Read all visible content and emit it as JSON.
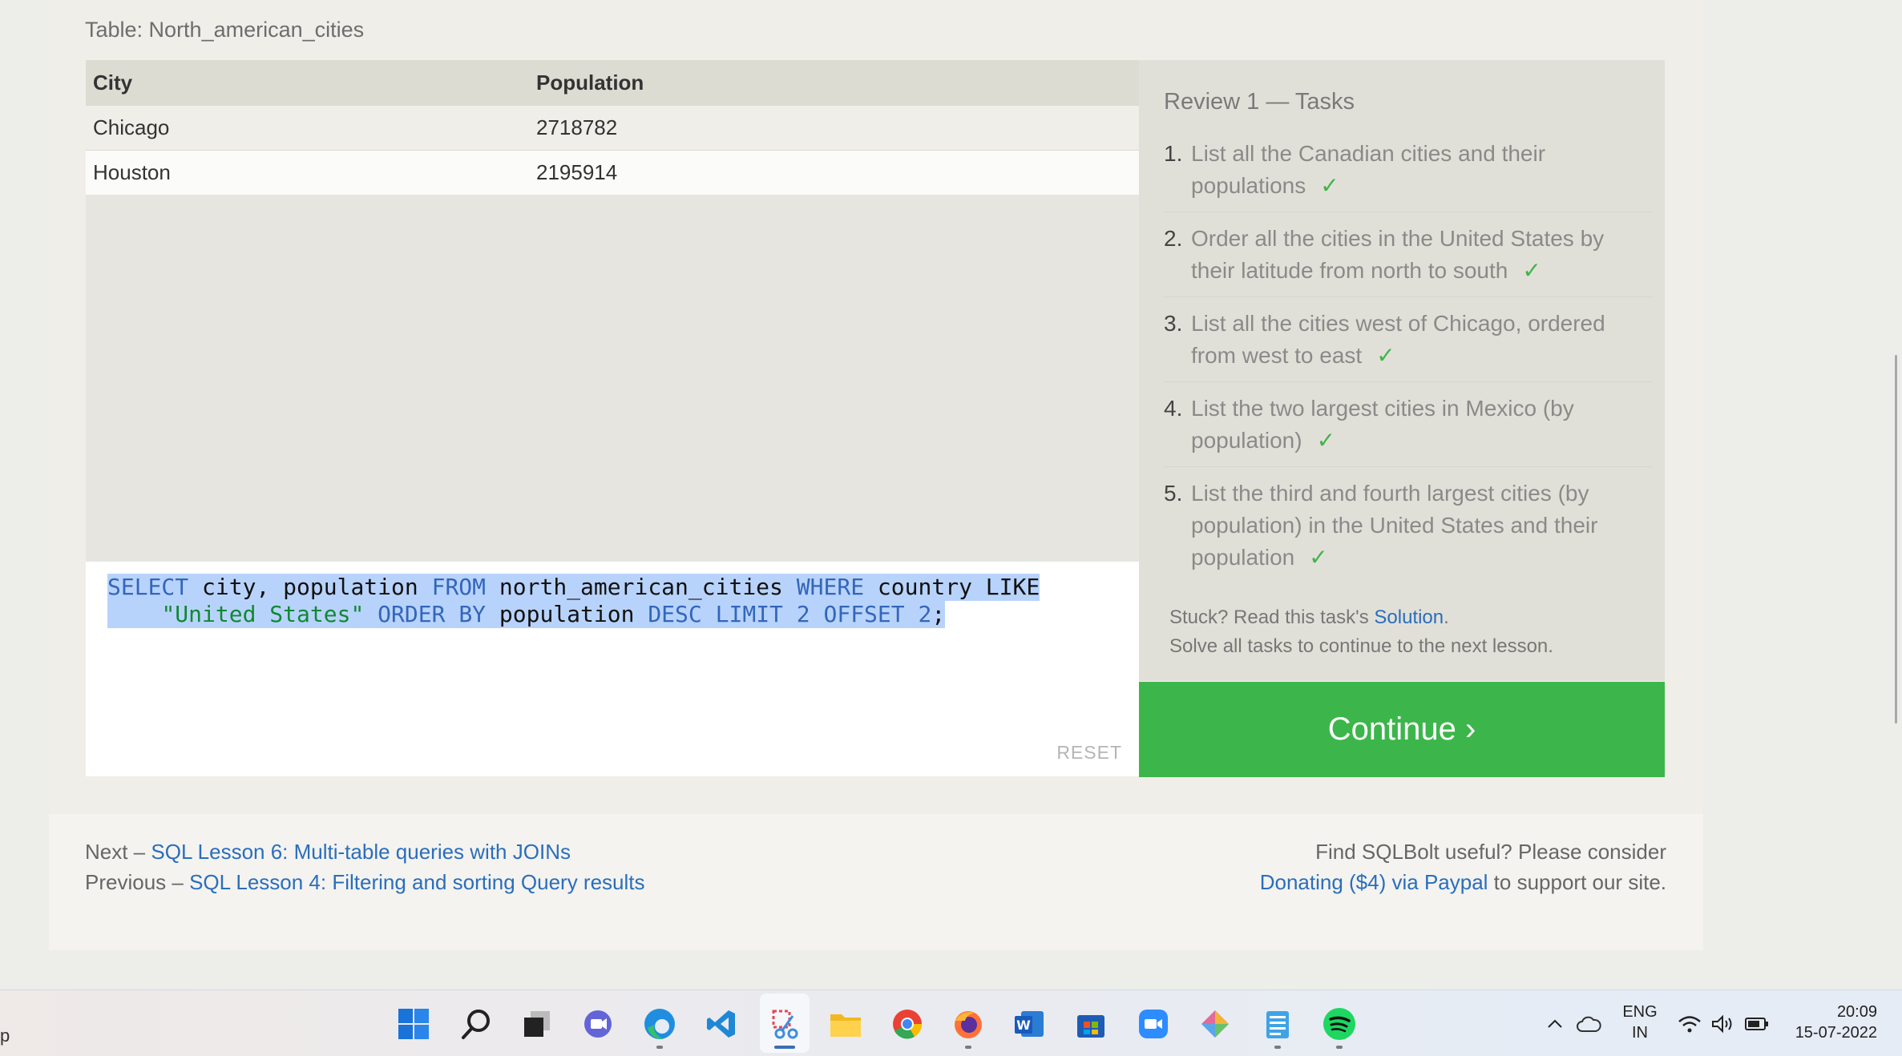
{
  "table_caption": "Table: North_american_cities",
  "results": {
    "columns": [
      "City",
      "Population"
    ],
    "rows": [
      [
        "Chicago",
        "2718782"
      ],
      [
        "Houston",
        "2195914"
      ]
    ]
  },
  "editor": {
    "line1": [
      {
        "t": "SELECT",
        "c": "kw"
      },
      {
        "t": " city, population ",
        "c": "id"
      },
      {
        "t": "FROM",
        "c": "kw"
      },
      {
        "t": " north_american_cities ",
        "c": "id"
      },
      {
        "t": "WHERE",
        "c": "kw"
      },
      {
        "t": " country LIKE",
        "c": "id"
      }
    ],
    "line2": [
      {
        "t": "    ",
        "c": "id"
      },
      {
        "t": "\"United States\"",
        "c": "str"
      },
      {
        "t": " ",
        "c": "id"
      },
      {
        "t": "ORDER BY",
        "c": "kw"
      },
      {
        "t": " population ",
        "c": "id"
      },
      {
        "t": "DESC LIMIT 2 OFFSET 2",
        "c": "kw"
      },
      {
        "t": ";",
        "c": "id"
      }
    ],
    "reset_label": "RESET"
  },
  "tasks": {
    "title": "Review 1 — Tasks",
    "items": [
      {
        "num": "1.",
        "text": "List all the Canadian cities and their populations",
        "check": "✓"
      },
      {
        "num": "2.",
        "text": "Order all the cities in the United States by their latitude from north to south",
        "check": "✓"
      },
      {
        "num": "3.",
        "text": "List all the cities west of Chicago, ordered from west to east",
        "check": "✓"
      },
      {
        "num": "4.",
        "text": "List the two largest cities in Mexico (by population)",
        "check": "✓"
      },
      {
        "num": "5.",
        "text": "List the third and fourth largest cities (by population) in the United States and their population",
        "check": "✓"
      }
    ],
    "stuck_prefix": "Stuck? Read this task's ",
    "solution_link": "Solution",
    "stuck_suffix": ".",
    "solve_note": "Solve all tasks to continue to the next lesson."
  },
  "continue_label": "Continue ›",
  "footer": {
    "next_prefix": "Next – ",
    "next_link": "SQL Lesson 6: Multi-table queries with JOINs",
    "prev_prefix": "Previous – ",
    "prev_link": "SQL Lesson 4: Filtering and sorting Query results",
    "support_line": "Find SQLBolt useful? Please consider",
    "donate_link": "Donating ($4) via Paypal",
    "donate_suffix": " to support our site."
  },
  "taskbar": {
    "cut_text": "p",
    "apps": [
      "windows-start-icon",
      "search-icon",
      "task-view-icon",
      "teams-chat-icon",
      "edge-icon",
      "vscode-icon",
      "snipping-tool-icon",
      "file-explorer-icon",
      "chrome-icon",
      "firefox-icon",
      "word-icon",
      "store-icon",
      "zoom-icon",
      "dev-tool-icon",
      "notepad-icon",
      "spotify-icon"
    ],
    "lang_top": "ENG",
    "lang_bottom": "IN",
    "time": "20:09",
    "date": "15-07-2022"
  }
}
